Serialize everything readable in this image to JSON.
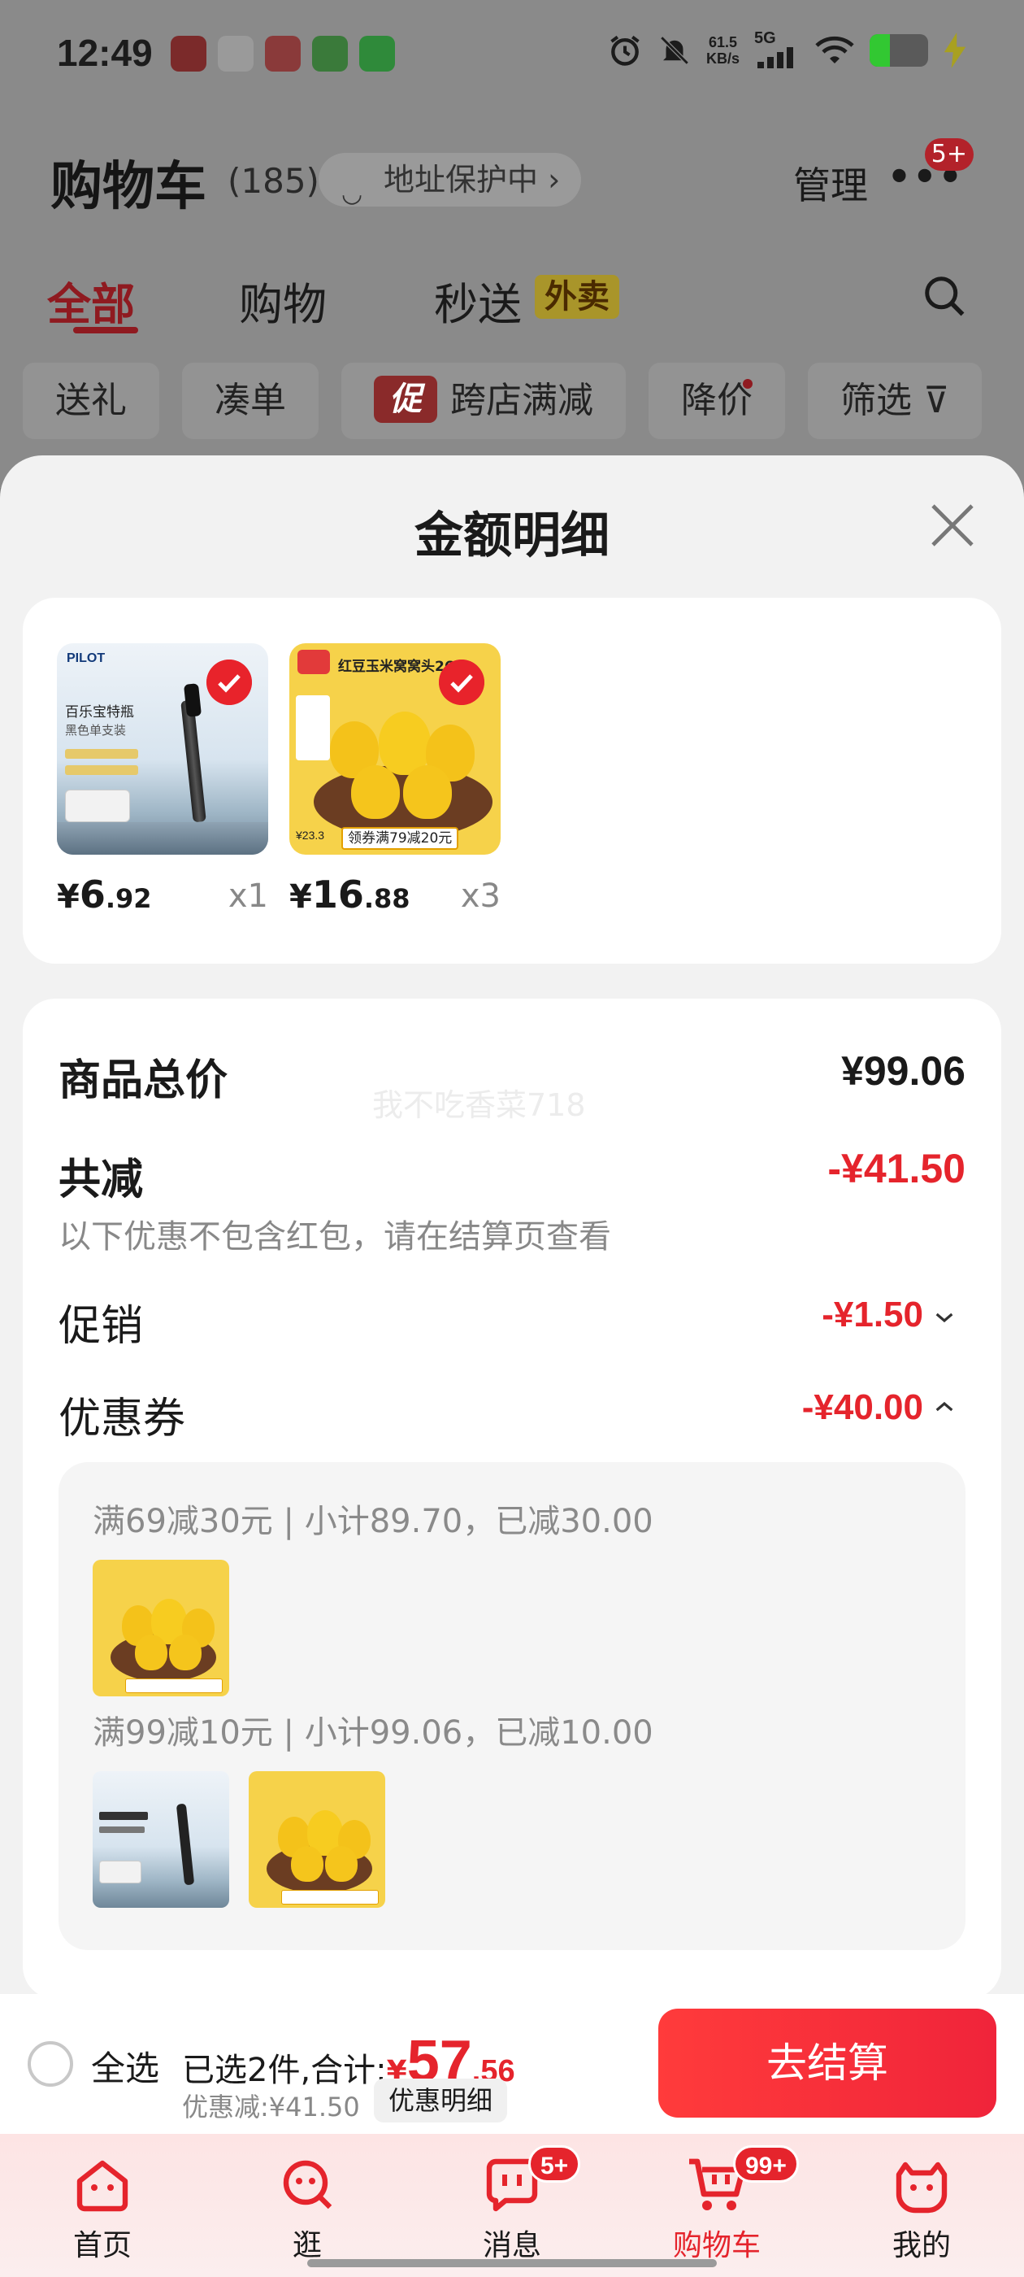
{
  "status_bar": {
    "time": "12:49",
    "net_speed": "61.5",
    "net_unit": "KB/s",
    "network": "5G",
    "battery_level": 0.35
  },
  "cart_header": {
    "title": "购物车",
    "count": "(185)",
    "address_protect": "地址保护中 ›",
    "manage": "管理",
    "more_badge": "5+"
  },
  "category_tabs": [
    {
      "label": "全部",
      "active": true
    },
    {
      "label": "购物",
      "active": false
    },
    {
      "label": "秒送",
      "active": false
    }
  ],
  "waimai_badge": "外卖",
  "filters": [
    {
      "label": "送礼"
    },
    {
      "label": "凑单"
    },
    {
      "label": "跨店满减",
      "tag": "促"
    },
    {
      "label": "降价"
    },
    {
      "label": "筛选"
    }
  ],
  "sheet": {
    "title": "金额明细",
    "products": [
      {
        "name": "百乐宝特瓶",
        "price_yen": "¥",
        "price_int": "6",
        "price_dec": ".92",
        "qty": "x1",
        "checked": true
      },
      {
        "name": "红豆玉米窝窝头260g",
        "price_yen": "¥",
        "price_int": "16",
        "price_dec": ".88",
        "qty": "x3",
        "checked": true
      }
    ],
    "summary": {
      "total_label": "商品总价",
      "total_value": "¥99.06",
      "watermark": "我不吃香菜718",
      "reduce_label": "共减",
      "reduce_value": "-¥41.50",
      "reduce_note": "以下优惠不包含红包，请在结算页查看",
      "promo_label": "促销",
      "promo_value": "-¥1.50",
      "coupon_label": "优惠券",
      "coupon_value": "-¥40.00"
    },
    "coupons": [
      {
        "line": "满69减30元 | 小计89.70，已减30.00"
      },
      {
        "line": "满99减10元 | 小计99.06，已减10.00"
      }
    ]
  },
  "product_images": {
    "pen_brand": "PILOT",
    "pen_line1": "百乐宝特瓶",
    "pen_line2": "黑色单支装",
    "wowotou_title": "红豆玉米窝窝头260g",
    "wowotou_promo": "领券满79减20元",
    "wowotou_price": "¥23.3"
  },
  "checkout": {
    "select_all": "全选",
    "summary_prefix": "已选2件,合计:",
    "yen": "¥",
    "total_int": "57",
    "total_dec": ".56",
    "discount": "优惠减:¥41.50",
    "detail_button": "优惠明细",
    "checkout_button": "去结算"
  },
  "tabbar": [
    {
      "label": "首页",
      "icon": "home-icon",
      "badge": ""
    },
    {
      "label": "逛",
      "icon": "browse-icon",
      "badge": ""
    },
    {
      "label": "消息",
      "icon": "message-icon",
      "badge": "5+"
    },
    {
      "label": "购物车",
      "icon": "cart-icon",
      "badge": "99+",
      "active": true
    },
    {
      "label": "我的",
      "icon": "profile-icon",
      "badge": ""
    }
  ],
  "colors": {
    "accent_red": "#e5242c",
    "dim_overlay": "#7a7a7a",
    "sheet_bg": "#f2f2f2"
  }
}
